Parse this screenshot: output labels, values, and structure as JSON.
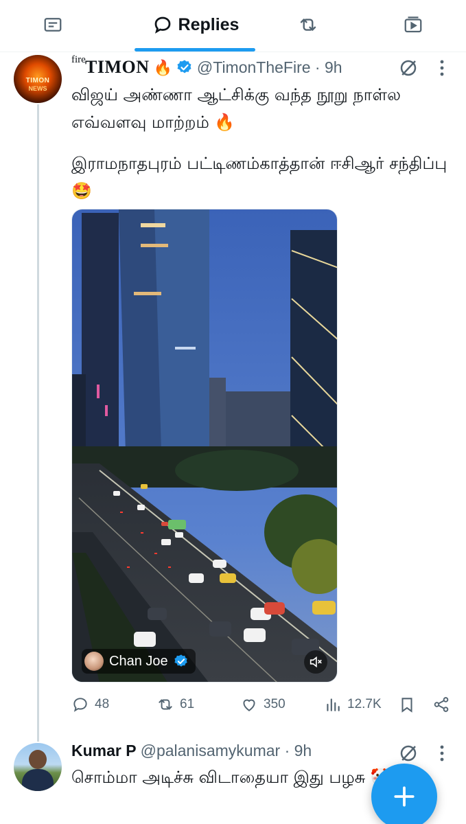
{
  "tabs": {
    "active_label": "Replies"
  },
  "tweet": {
    "name_prefix": "fire",
    "name": "TIMON",
    "name_emoji": "🔥",
    "handle": "@TimonTheFire · 9h",
    "avatar_text_1": "TIMON",
    "avatar_text_2": "NEWS",
    "text_line1": "விஜய் அண்ணா ஆட்சிக்கு வந்த நூறு நாள்ல எவ்வளவு மாற்றம் 🔥",
    "text_line2": "இராமநாதபுரம் பட்டிணம்காத்தான் ஈசிஆர் சந்திப்பு 🤩",
    "media_credit": "Chan Joe",
    "replies": "48",
    "reposts": "61",
    "likes": "350",
    "views": "12.7K"
  },
  "reply": {
    "name": "Kumar P",
    "handle": "@palanisamykumar · 9h",
    "text": "சொம்மா அடிச்சு விடாதையா இது பழசு 🤡"
  },
  "colors": {
    "accent": "#1d9bf0",
    "muted": "#536471",
    "text": "#0f1419"
  },
  "icons": [
    "news-icon",
    "reply-bubble-icon",
    "repost-icon",
    "video-icon",
    "verified-badge-icon",
    "grok-icon",
    "more-icon",
    "mute-icon",
    "like-icon",
    "views-icon",
    "bookmark-icon",
    "share-icon",
    "plus-icon"
  ]
}
